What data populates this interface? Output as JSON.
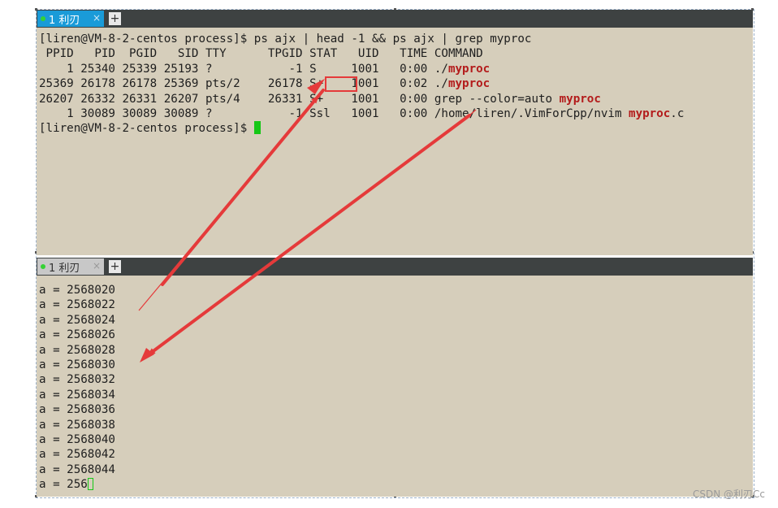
{
  "top_pane": {
    "tab": {
      "label": "1 利刃",
      "close": "×",
      "add": "+"
    },
    "lines": [
      [
        {
          "t": "[liren@VM-8-2-centos process]$ ps ajx | head -1 && ps ajx | grep myproc"
        }
      ],
      [
        {
          "t": " PPID   PID  PGID   SID TTY      TPGID STAT   UID   TIME COMMAND"
        }
      ],
      [
        {
          "t": "    1 25340 25339 25193 ?           -1 S     1001   0:00 ./"
        },
        {
          "t": "myproc",
          "hl": true
        }
      ],
      [
        {
          "t": "25369 26178 26178 25369 pts/2    26178 S+    1001   0:02 ./"
        },
        {
          "t": "myproc",
          "hl": true
        }
      ],
      [
        {
          "t": "26207 26332 26331 26207 pts/4    26331 S+    1001   0:00 grep --color=auto "
        },
        {
          "t": "myproc",
          "hl": true
        }
      ],
      [
        {
          "t": "    1 30089 30089 30089 ?           -1 Ssl   1001   0:00 /home/liren/.VimForCpp/nvim "
        },
        {
          "t": "myproc",
          "hl": true
        },
        {
          "t": ".c"
        }
      ],
      [
        {
          "t": "[liren@VM-8-2-centos process]$ "
        },
        {
          "cursor": "block"
        }
      ]
    ]
  },
  "bottom_pane": {
    "tab": {
      "label": "1 利刃",
      "close": "×",
      "add": "+"
    },
    "lines": [
      [
        {
          "t": "a = 2568020"
        }
      ],
      [
        {
          "t": "a = 2568022"
        }
      ],
      [
        {
          "t": "a = 2568024"
        }
      ],
      [
        {
          "t": "a = 2568026"
        }
      ],
      [
        {
          "t": "a = 2568028"
        }
      ],
      [
        {
          "t": "a = 2568030"
        }
      ],
      [
        {
          "t": "a = 2568032"
        }
      ],
      [
        {
          "t": "a = 2568034"
        }
      ],
      [
        {
          "t": "a = 2568036"
        }
      ],
      [
        {
          "t": "a = 2568038"
        }
      ],
      [
        {
          "t": "a = 2568040"
        }
      ],
      [
        {
          "t": "a = 2568042"
        }
      ],
      [
        {
          "t": "a = 2568044"
        }
      ],
      [
        {
          "t": "a = 256"
        },
        {
          "cursor": "outline"
        }
      ]
    ]
  },
  "annotation": {
    "color": "#e53a3a",
    "boxed_text": "S+"
  },
  "watermark": "CSDN @利刃Cc"
}
